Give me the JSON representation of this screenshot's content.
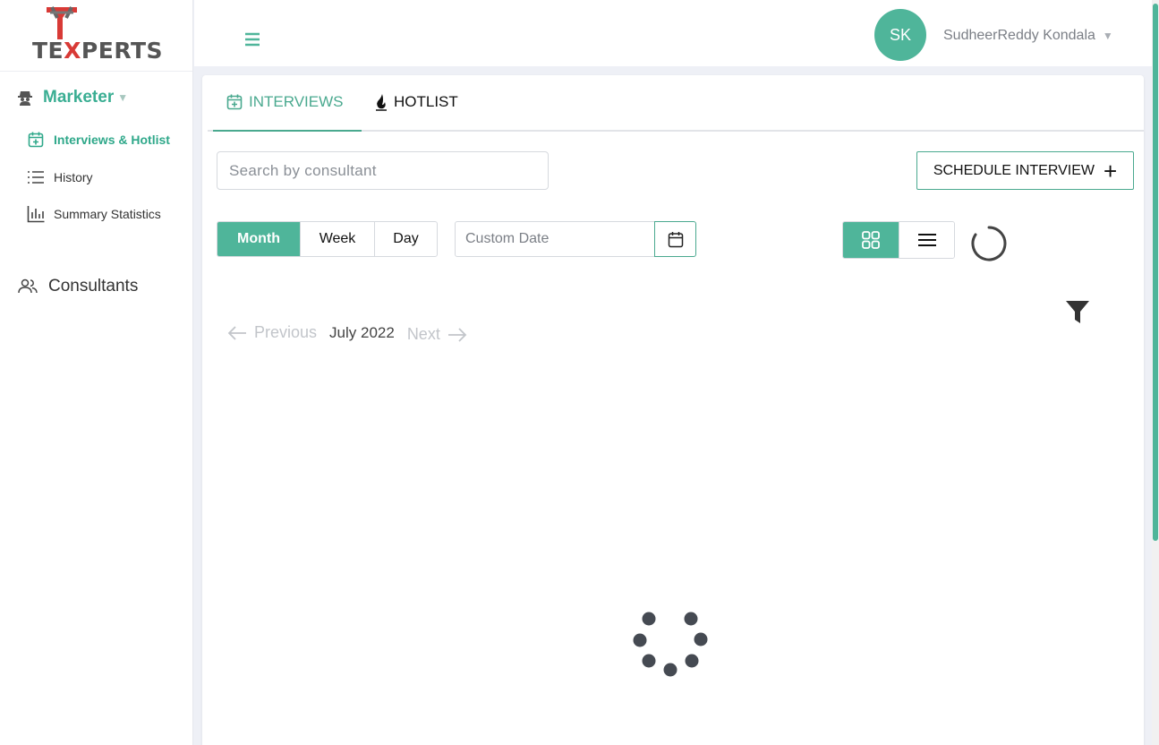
{
  "brand": {
    "logo_text_pre": "TE",
    "logo_text_x": "X",
    "logo_text_post": "PERTS",
    "accent": "#4fb59a",
    "logo_red": "#d83a36"
  },
  "sidebar": {
    "group_label": "Marketer",
    "items": [
      {
        "label": "Interviews & Hotlist",
        "icon": "calendar-plus-icon",
        "active": true
      },
      {
        "label": "History",
        "icon": "list-icon"
      },
      {
        "label": "Summary Statistics",
        "icon": "bar-chart-icon"
      }
    ],
    "consultants_label": "Consultants"
  },
  "user": {
    "initials": "SK",
    "name": "SudheerReddy Kondala"
  },
  "tabs": [
    {
      "label": "INTERVIEWS"
    },
    {
      "label": "HOTLIST"
    }
  ],
  "search": {
    "placeholder": "Search by consultant"
  },
  "schedule_button": {
    "label": "SCHEDULE INTERVIEW"
  },
  "view_range": {
    "options": [
      "Month",
      "Week",
      "Day"
    ],
    "selected": "Month"
  },
  "custom_date": {
    "placeholder": "Custom Date"
  },
  "pager": {
    "prev": "Previous",
    "current": "July 2022",
    "next": "Next"
  }
}
